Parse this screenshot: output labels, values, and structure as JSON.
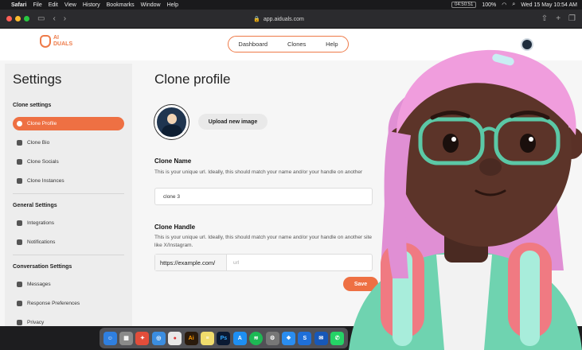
{
  "menubar": {
    "app": "Safari",
    "menus": [
      "File",
      "Edit",
      "View",
      "History",
      "Bookmarks",
      "Window",
      "Help"
    ],
    "timer": "04:50:51",
    "battery": "100%",
    "datetime": "Wed 15 May  10:54 AM"
  },
  "browser": {
    "url": "app.aiduals.com"
  },
  "topnav": {
    "logo_line1": "AI",
    "logo_line2": "DUALS",
    "links": [
      "Dashboard",
      "Clones",
      "Help"
    ]
  },
  "sidebar": {
    "title": "Settings",
    "sections": [
      {
        "title": "Clone settings",
        "items": [
          "Clone Profile",
          "Clone Bio",
          "Clone Socials",
          "Clone Instances"
        ]
      },
      {
        "title": "General Settings",
        "items": [
          "Integrations",
          "Notifications"
        ]
      },
      {
        "title": "Conversation Settings",
        "items": [
          "Messages",
          "Response Preferences",
          "Privacy"
        ]
      }
    ]
  },
  "main": {
    "title": "Clone profile",
    "upload_label": "Upload new image",
    "clone_name": {
      "label": "Clone Name",
      "help": "This is your unique url. Ideally, this should match your name and/or your handle on another",
      "value": "clone 3"
    },
    "clone_handle": {
      "label": "Clone Handle",
      "help": "This is your unique url. Ideally, this should match your name and/or your handle on another site like X/Instagram.",
      "prefix": "https://example.com/",
      "placeholder": "url"
    },
    "save_label": "Save"
  },
  "dock": {
    "apps": [
      "Ai",
      "Ps",
      "S"
    ]
  },
  "colors": {
    "accent": "#ee7043",
    "page_bg": "#f6f6f6",
    "sidebar_bg": "#ededed"
  }
}
